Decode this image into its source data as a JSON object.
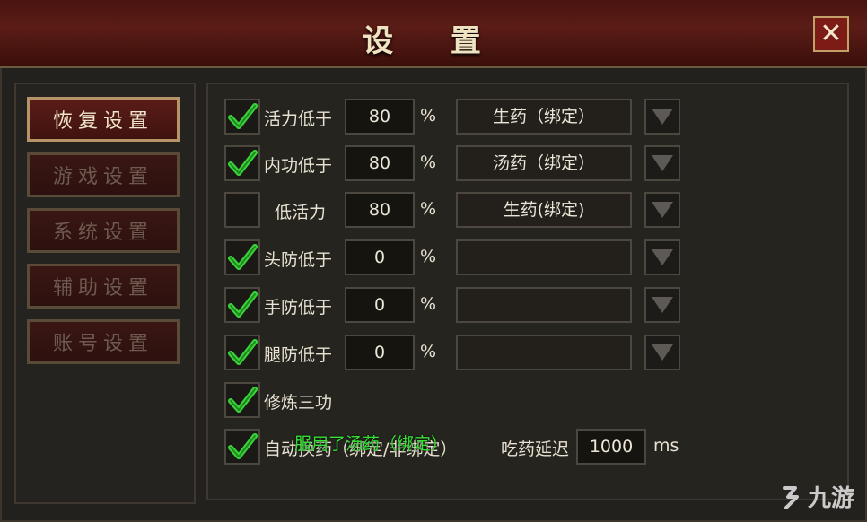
{
  "window": {
    "title": "设 置",
    "close_label": "✕"
  },
  "sidebar": {
    "items": [
      {
        "label": "恢复设置",
        "active": true
      },
      {
        "label": "游戏设置",
        "active": false
      },
      {
        "label": "系统设置",
        "active": false
      },
      {
        "label": "辅助设置",
        "active": false
      },
      {
        "label": "账号设置",
        "active": false
      }
    ]
  },
  "rows": [
    {
      "checked": true,
      "label": "活力低于",
      "value": "80",
      "unit": "%",
      "item": "生药（绑定）"
    },
    {
      "checked": true,
      "label": "内功低于",
      "value": "80",
      "unit": "%",
      "item": "汤药（绑定）"
    },
    {
      "checked": false,
      "label": "低活力",
      "value": "80",
      "unit": "%",
      "item": "生药(绑定)"
    },
    {
      "checked": true,
      "label": "头防低于",
      "value": "0",
      "unit": "%",
      "item": ""
    },
    {
      "checked": true,
      "label": "手防低于",
      "value": "0",
      "unit": "%",
      "item": ""
    },
    {
      "checked": true,
      "label": "腿防低于",
      "value": "0",
      "unit": "%",
      "item": ""
    }
  ],
  "cultivate": {
    "checked": true,
    "label": "修炼三功"
  },
  "auto": {
    "checked": true,
    "label": "自动换药（绑定/非绑定）",
    "delay_label": "吃药延迟",
    "delay_value": "1000",
    "delay_unit": "ms"
  },
  "message": "服用了汤药（绑定）",
  "watermark": "九游",
  "colors": {
    "accent_green": "#34e034",
    "title_red": "#5b1c16"
  }
}
